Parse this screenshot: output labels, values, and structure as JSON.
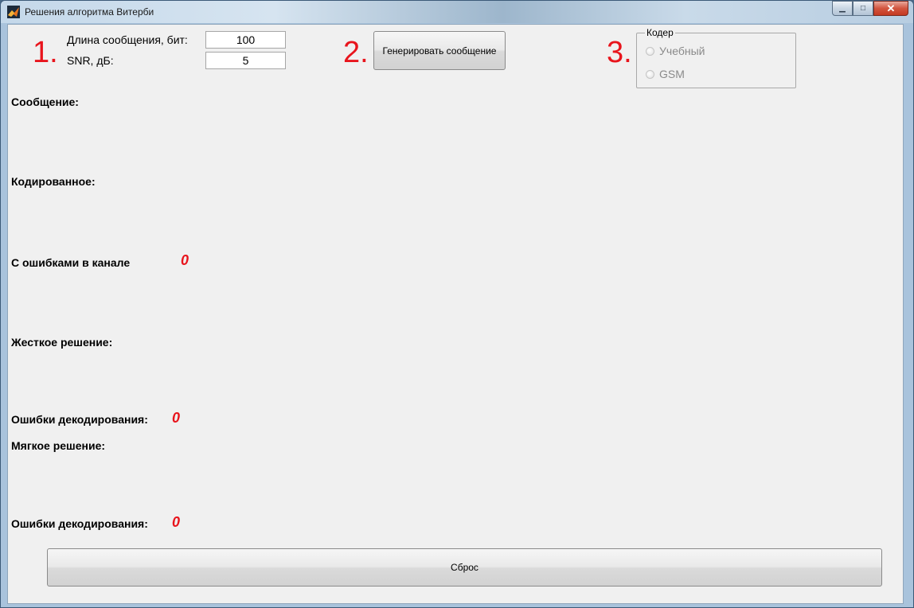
{
  "window": {
    "title": "Решения алгоритма Витерби"
  },
  "steps": {
    "step1": "1.",
    "step2": "2.",
    "step3": "3."
  },
  "params": {
    "length_label": "Длина сообщения, бит:",
    "length_value": "100",
    "snr_label": "SNR, дБ:",
    "snr_value": "5"
  },
  "generate_button": "Генерировать сообщение",
  "coder": {
    "title": "Кодер",
    "options": [
      "Учебный",
      "GSM"
    ]
  },
  "sections": {
    "message": "Сообщение:",
    "encoded": "Кодированное:",
    "channel_errors": "С ошибками в канале",
    "channel_errors_count": "0",
    "hard_decision": "Жесткое решение:",
    "hard_errors_label": "Ошибки декодирования:",
    "hard_errors_count": "0",
    "soft_decision": "Мягкое решение:",
    "soft_errors_label": "Ошибки декодирования:",
    "soft_errors_count": "0"
  },
  "reset_button": "Сброс",
  "colors": {
    "accent_red": "#e8141c"
  }
}
